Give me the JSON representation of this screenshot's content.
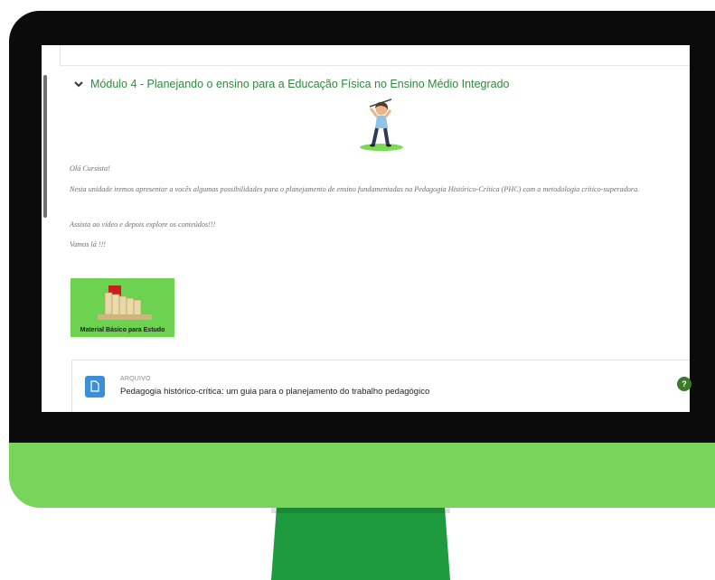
{
  "module": {
    "title": "Módulo 4 - Planejando o ensino para a Educação Física no Ensino Médio Integrado"
  },
  "intro": {
    "greeting": "Olá Cursista!",
    "paragraph": "Nesta unidade iremos apresentar a vocês algumas possibilidades para o planejamento de ensino fundamentadas na Pedagogia Histórico-Crítica (PHC) com a metodologia crítico-superadora.",
    "instruction": "Assista ao vídeo e depois explore os conteúdos!!!",
    "closing": "Vamos lá !!!"
  },
  "material": {
    "label": "Material Básico para Estudo"
  },
  "resource": {
    "type": "ARQUIVO",
    "title": "Pedagogia histórico-crítica: um guia para o planejamento do trabalho pedagógico"
  },
  "help": {
    "symbol": "?"
  },
  "colors": {
    "accent": "#2f8a3c",
    "monitor_green": "#79d45c",
    "stand_green": "#1f9b3f",
    "file_icon": "#3a8fd9"
  }
}
